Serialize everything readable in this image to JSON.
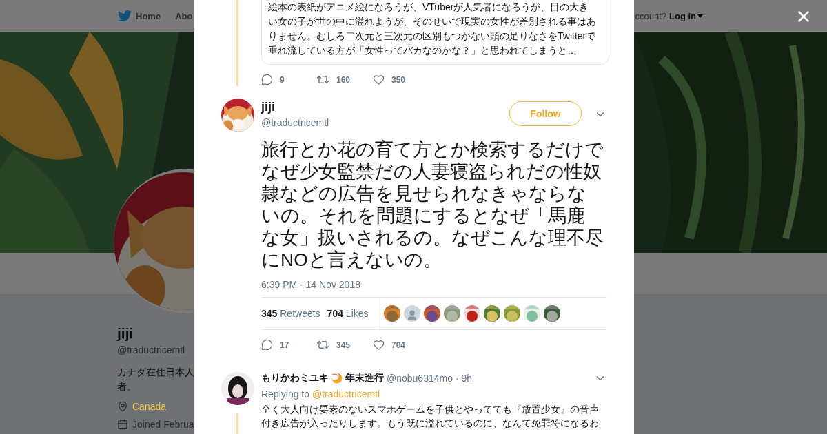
{
  "background_page": {
    "nav": [
      {
        "kind": "home",
        "label": "Home"
      },
      {
        "kind": "plain",
        "label": "Abo"
      }
    ],
    "login_prompt": "ccount?",
    "login": "Log in",
    "profile": {
      "name": "jiji",
      "handle": "@traductricemtl",
      "bio": [
        "カナダ在住日本人",
        "者。"
      ],
      "location": "Canada",
      "joined": "Joined Februa"
    }
  },
  "modal": {
    "quoted_tweet": {
      "lines": [
        "絵本の表紙がアニメ絵になろうが、VTuberが人気者になろうが、目の大き",
        "い女の子が世の中に溢れようが、そのせいで現実の女性が差別される事はあ",
        "りません。むしろ二次元と三次元の区別もつかない頭の足りなさをTwitterで",
        "垂れ流している方が「女性ってバカなのかな？」と思われてしまうと…"
      ],
      "actions": [
        {
          "kind": "reply",
          "count": "9"
        },
        {
          "kind": "retweet",
          "count": "160"
        },
        {
          "kind": "like",
          "count": "350"
        }
      ]
    },
    "tweet": {
      "name": "jiji",
      "handle": "@traductricemtl",
      "follow": "Follow",
      "lines": [
        "旅行とか花の育て方とか検索するだけで",
        "なぜ少女監禁だの人妻寝盗られだの性奴",
        "隷などの広告を見せられなきゃならな",
        "いの。それを問題にするとなぜ「馬鹿",
        "な女」扱いされるの。なぜこんな理不尽",
        "にNOと言えないの。"
      ],
      "timestamp": "6:39 PM - 14 Nov 2018",
      "retweets": {
        "count": "345",
        "label": "Retweets"
      },
      "likes": {
        "count": "704",
        "label": "Likes"
      },
      "likers": [
        {
          "kind": "picture"
        },
        {
          "kind": "default"
        },
        {
          "kind": "picture"
        },
        {
          "kind": "picture"
        },
        {
          "kind": "picture"
        },
        {
          "kind": "picture"
        },
        {
          "kind": "picture"
        },
        {
          "kind": "picture"
        },
        {
          "kind": "picture"
        }
      ],
      "actions": [
        {
          "kind": "reply",
          "count": "17"
        },
        {
          "kind": "retweet",
          "count": "345"
        },
        {
          "kind": "like",
          "count": "704"
        }
      ]
    },
    "reply": {
      "name": "もりかわミユキ",
      "name_suffix": "年末進行",
      "handle": "@nobu6314mo",
      "time": "· 9h",
      "replying_label": "Replying to",
      "replying_to": "@traductricemtl",
      "lines": [
        "全く大人向け要素のないスマホゲームを子供とやってても『放置少女』の音声",
        "付き広告が入ったりします。もう既に溢れているのに、なんて免罪符になるわ"
      ]
    }
  }
}
